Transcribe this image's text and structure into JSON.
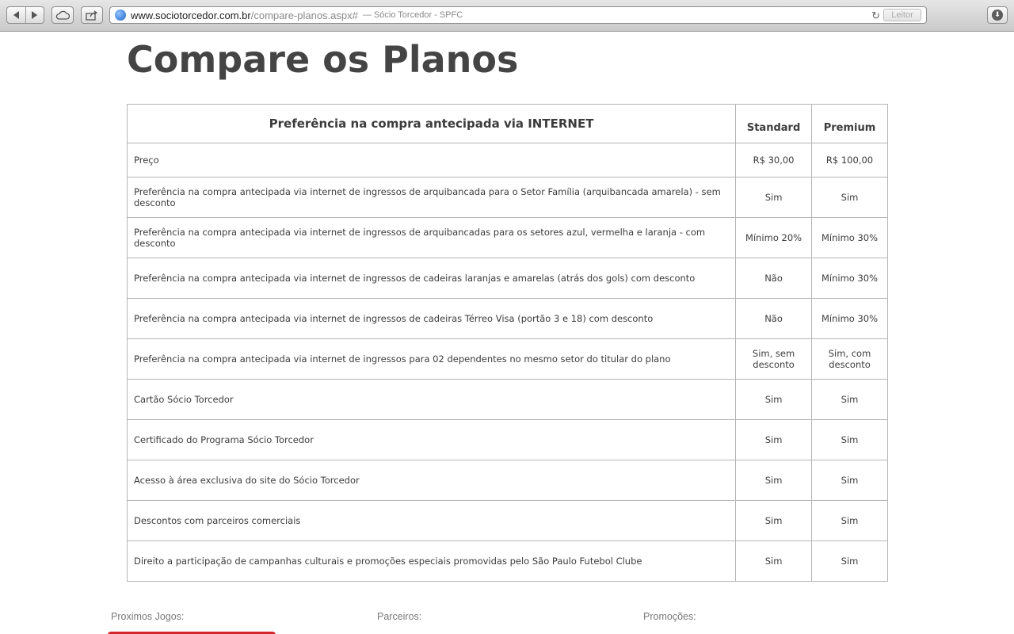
{
  "browser": {
    "url_host": "www.sociotorcedor.com.br",
    "url_path": "/compare-planos.aspx#",
    "page_title": "— Sócio Torcedor - SPFC",
    "reader_label": "Leitor"
  },
  "page": {
    "title": "Compare os Planos"
  },
  "table": {
    "header": {
      "feature": "Preferência na compra antecipada via INTERNET",
      "standard": "Standard",
      "premium": "Premium"
    },
    "rows": [
      {
        "feature": "Preço",
        "standard": "R$ 30,00",
        "premium": "R$ 100,00"
      },
      {
        "feature": "Preferência na compra antecipada via internet de ingressos de arquibancada para o Setor Família (arquibancada amarela) - sem desconto",
        "standard": "Sim",
        "premium": "Sim"
      },
      {
        "feature": "Preferência na compra antecipada via internet de ingressos de arquibancadas para os setores azul, vermelha e laranja - com desconto",
        "standard": "Mínimo 20%",
        "premium": "Mínimo 30%"
      },
      {
        "feature": "Preferência na compra antecipada via internet de ingressos de cadeiras laranjas e amarelas (atrás dos gols) com desconto",
        "standard": "Não",
        "premium": "Mínimo 30%"
      },
      {
        "feature": "Preferência na compra antecipada via internet de ingressos de cadeiras Térreo Visa (portão 3 e 18) com desconto",
        "standard": "Não",
        "premium": "Mínimo 30%"
      },
      {
        "feature": "Preferência na compra antecipada via internet de ingressos para 02 dependentes no mesmo setor do titular do plano",
        "standard": "Sim, sem desconto",
        "premium": "Sim, com desconto"
      },
      {
        "feature": "Cartão Sócio Torcedor",
        "standard": "Sim",
        "premium": "Sim"
      },
      {
        "feature": "Certificado do Programa Sócio Torcedor",
        "standard": "Sim",
        "premium": "Sim"
      },
      {
        "feature": "Acesso à área exclusiva do site do Sócio Torcedor",
        "standard": "Sim",
        "premium": "Sim"
      },
      {
        "feature": "Descontos com parceiros comerciais",
        "standard": "Sim",
        "premium": "Sim"
      },
      {
        "feature": " Direito a participação de campanhas culturais e promoções especiais promovidas pelo São Paulo Futebol Clube",
        "standard": "Sim",
        "premium": "Sim"
      }
    ]
  },
  "footer": {
    "games_label": "Proximos Jogos:",
    "partners_label": "Parceiros:",
    "promotions_label": "Promoções:"
  },
  "colors": {
    "accent_red": "#d2252c",
    "text_dark": "#3c3c3c",
    "border": "#b5b5b5"
  },
  "icons": [
    "back-icon",
    "forward-icon",
    "icloud-icon",
    "share-icon",
    "globe-icon",
    "reload-icon",
    "download-icon"
  ]
}
